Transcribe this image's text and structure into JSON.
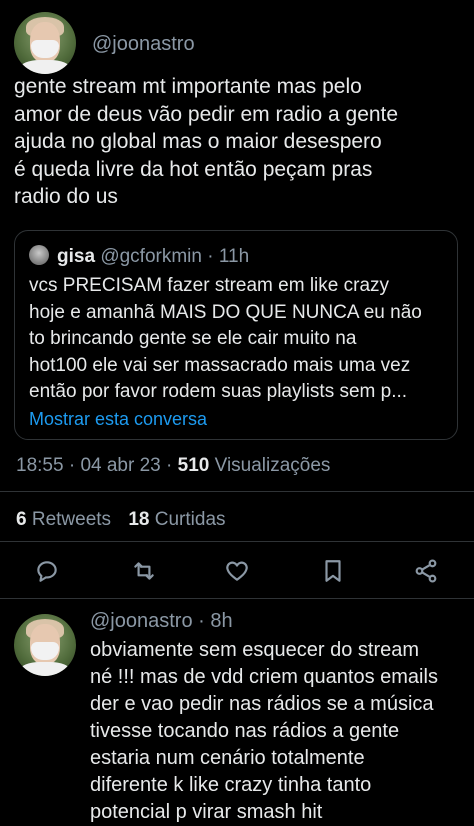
{
  "tweet": {
    "handle": "@joonastro",
    "text": "gente stream mt importante mas pelo\namor de deus vão pedir em radio a gente\najuda no global mas o maior desespero\né queda livre da hot então peçam pras\nradio do us",
    "quote": {
      "name": "gisa",
      "handle": "@gcforkmin",
      "sep": "·",
      "time": "11h",
      "text": "vcs PRECISAM fazer stream em like crazy\nhoje e amanhã MAIS DO QUE NUNCA eu não\nto brincando gente se ele cair muito na\nhot100 ele vai ser massacrado mais uma vez\nentão por favor rodem suas playlists sem p...",
      "show_thread": "Mostrar esta conversa"
    },
    "meta": {
      "time": "18:55",
      "sep1": "·",
      "date": "04 abr 23",
      "sep2": "·",
      "views_count": "510",
      "views_label": "Visualizações"
    },
    "stats": {
      "retweets_count": "6",
      "retweets_label": "Retweets",
      "likes_count": "18",
      "likes_label": "Curtidas"
    }
  },
  "reply": {
    "handle": "@joonastro",
    "sep": "·",
    "time": "8h",
    "text": "obviamente sem esquecer do stream\nné !!! mas de vdd criem quantos emails\nder e vao pedir nas rádios se a música\ntivesse tocando nas rádios a gente\nestaria num cenário totalmente\ndiferente k like crazy tinha tanto\npotencial p virar smash hit"
  },
  "icons": [
    "reply-icon",
    "retweet-icon",
    "like-icon",
    "bookmark-icon",
    "share-icon"
  ],
  "colors": {
    "background": "#000000",
    "text": "#e7e9ea",
    "muted": "#8b98a5",
    "link": "#1d9bf0",
    "border": "#2f3336"
  }
}
